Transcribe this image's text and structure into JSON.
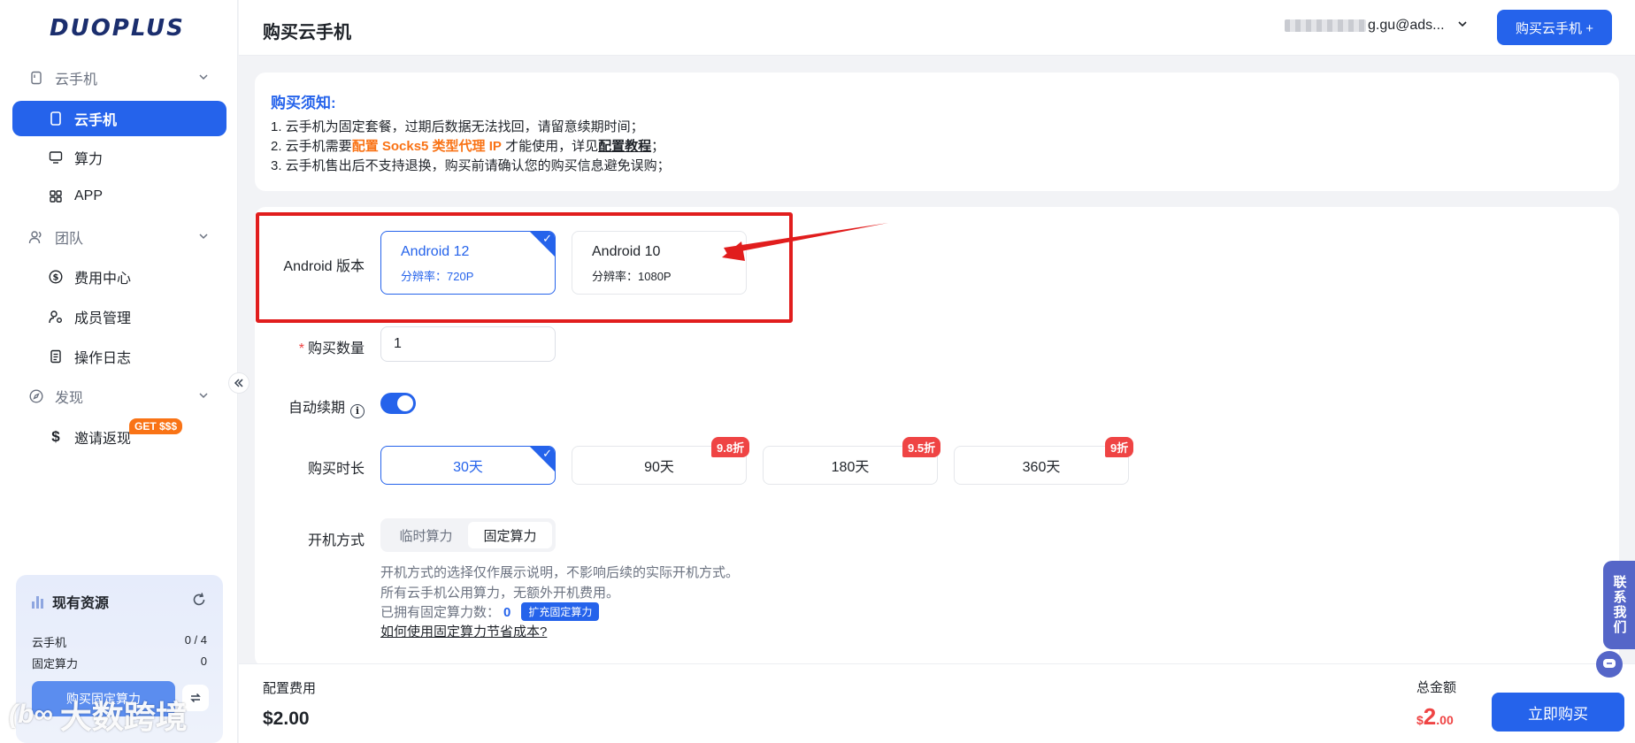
{
  "brand": {
    "logo_text": "DUOPLUS"
  },
  "sidebar": {
    "groups": [
      {
        "label": "云手机"
      },
      {
        "label": "团队"
      },
      {
        "label": "发现"
      }
    ],
    "items": [
      {
        "label": "云手机"
      },
      {
        "label": "算力"
      },
      {
        "label": "APP"
      },
      {
        "label": "费用中心"
      },
      {
        "label": "成员管理"
      },
      {
        "label": "操作日志"
      },
      {
        "label": "邀请返现"
      }
    ],
    "promo_badge": "GET $$$"
  },
  "resources": {
    "title": "现有资源",
    "rows": [
      {
        "label": "云手机",
        "value": "0 / 4"
      },
      {
        "label": "固定算力",
        "value": "0"
      }
    ],
    "buy_button": "购买固定算力"
  },
  "watermark": {
    "logo": "(b∞",
    "text": "大数跨境"
  },
  "header": {
    "title": "购买云手机",
    "account_suffix": "g.gu@ads...",
    "buy_button": "购买云手机 +"
  },
  "notice": {
    "title": "购买须知:",
    "line1": "1. 云手机为固定套餐，过期后数据无法找回，请留意续期时间；",
    "line2_a": "2. 云手机需要",
    "line2_hl": "配置 Socks5 类型代理 IP",
    "line2_b": " 才能使用，详见",
    "line2_link": "配置教程",
    "line2_c": "；",
    "line3": "3. 云手机售出后不支持退换，购买前请确认您的购买信息避免误购；"
  },
  "form": {
    "android_label": "Android 版本",
    "android_options": [
      {
        "name": "Android 12",
        "resolution": "分辨率：720P"
      },
      {
        "name": "Android 10",
        "resolution": "分辨率：1080P"
      }
    ],
    "quantity_label": "购买数量",
    "quantity_value": "1",
    "auto_renew_label": "自动续期",
    "auto_renew_on": true,
    "duration_label": "购买时长",
    "durations": [
      {
        "label": "30天",
        "discount": ""
      },
      {
        "label": "90天",
        "discount": "9.8折"
      },
      {
        "label": "180天",
        "discount": "9.5折"
      },
      {
        "label": "360天",
        "discount": "9折"
      }
    ],
    "boot_label": "开机方式",
    "boot_options": [
      "临时算力",
      "固定算力"
    ],
    "boot_selected": "固定算力",
    "help1": "开机方式的选择仅作展示说明，不影响后续的实际开机方式。",
    "help2": "所有云手机公用算力，无额外开机费用。",
    "owned_label": "已拥有固定算力数：",
    "owned_value": "0",
    "expand_button": "扩充固定算力",
    "help_link": "如何使用固定算力节省成本?"
  },
  "footer": {
    "config_label": "配置费用",
    "config_value": "$2.00",
    "total_label": "总金额",
    "total_currency": "$",
    "total_int": "2",
    "total_dec": ".00",
    "buy_now": "立即购买"
  },
  "contact": {
    "label": "联系我们"
  },
  "colors": {
    "primary": "#2563eb",
    "warning": "#f97316",
    "danger": "#ef4444",
    "annotation": "#e11d1d"
  }
}
